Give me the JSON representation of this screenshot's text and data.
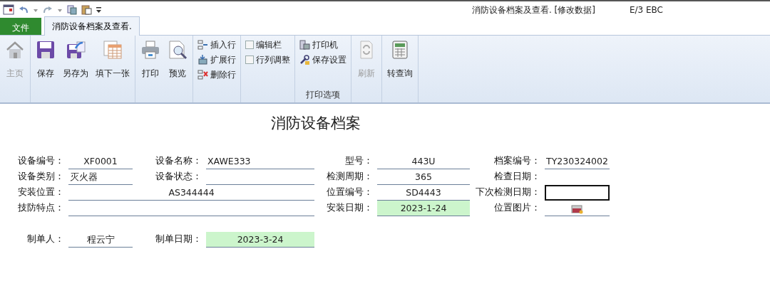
{
  "window": {
    "title": "消防设备档案及查看. [修改数据]",
    "app": "E/3 EBC"
  },
  "tabs": [
    {
      "label": "文件",
      "kind": "file",
      "selected": false
    },
    {
      "label": "消防设备档案及查看.",
      "kind": "page",
      "selected": true
    }
  ],
  "ribbon": [
    {
      "items": [
        {
          "kind": "large",
          "label": "主页",
          "disabled": true
        }
      ]
    },
    {
      "items": [
        {
          "kind": "large",
          "label": "保存",
          "disabled": false
        },
        {
          "kind": "large",
          "label": "另存为",
          "disabled": false
        },
        {
          "kind": "large",
          "label": "填下一张",
          "disabled": false
        }
      ]
    },
    {
      "items": [
        {
          "kind": "large",
          "label": "打印",
          "disabled": false
        },
        {
          "kind": "large",
          "label": "预览",
          "disabled": false
        }
      ]
    },
    {
      "items": [
        {
          "kind": "small",
          "label": "插入行",
          "disabled": false
        },
        {
          "kind": "small",
          "label": "扩展行",
          "disabled": false
        },
        {
          "kind": "small",
          "label": "删除行",
          "disabled": false
        }
      ]
    },
    {
      "items": [
        {
          "kind": "check",
          "label": "编辑栏",
          "checked": false,
          "disabled": false
        },
        {
          "kind": "check",
          "label": "行列调整",
          "checked": false,
          "disabled": false
        }
      ]
    },
    {
      "label": "打印选项",
      "items": [
        {
          "kind": "small",
          "label": "打印机",
          "disabled": false
        },
        {
          "kind": "small",
          "label": "保存设置",
          "disabled": false
        }
      ]
    },
    {
      "items": [
        {
          "kind": "large",
          "label": "刷新",
          "disabled": true
        }
      ]
    },
    {
      "items": [
        {
          "kind": "large",
          "label": "转查询",
          "disabled": false
        }
      ]
    }
  ],
  "form": {
    "title": "消防设备档案",
    "rows": [
      [
        {
          "label": "设备编号：",
          "value": "XF0001"
        },
        {
          "label": "设备名称：",
          "value": "XAWE333",
          "left_aligned": true
        },
        {
          "label": "型号：",
          "value": "443U"
        },
        {
          "label": "档案编号：",
          "value": "TY230324002"
        }
      ],
      [
        {
          "label": "设备类别：",
          "value": "灭火器",
          "left_aligned": true
        },
        {
          "label": "设备状态："
        },
        {
          "label": "检测周期：",
          "value": "365"
        },
        {
          "label": "检查日期：",
          "kind": "plain"
        }
      ],
      [
        {
          "label": "安装位置：",
          "value": "AS344444",
          "wide": true
        },
        {
          "label": "位置编号：",
          "value": "SD4443"
        },
        {
          "label": "下次检测日期：",
          "selected": true
        }
      ],
      [
        {
          "label": "技防特点：",
          "wide": true
        },
        {
          "label": "安装日期：",
          "value": "2023-1-24",
          "highlight": true
        },
        {
          "label": "位置图片：",
          "kind": "image"
        }
      ],
      [],
      [
        {
          "label": "制单人：",
          "value": "程云宁"
        },
        {
          "label": "制单日期：",
          "value": "2023-3-24",
          "highlight": true
        }
      ]
    ]
  }
}
